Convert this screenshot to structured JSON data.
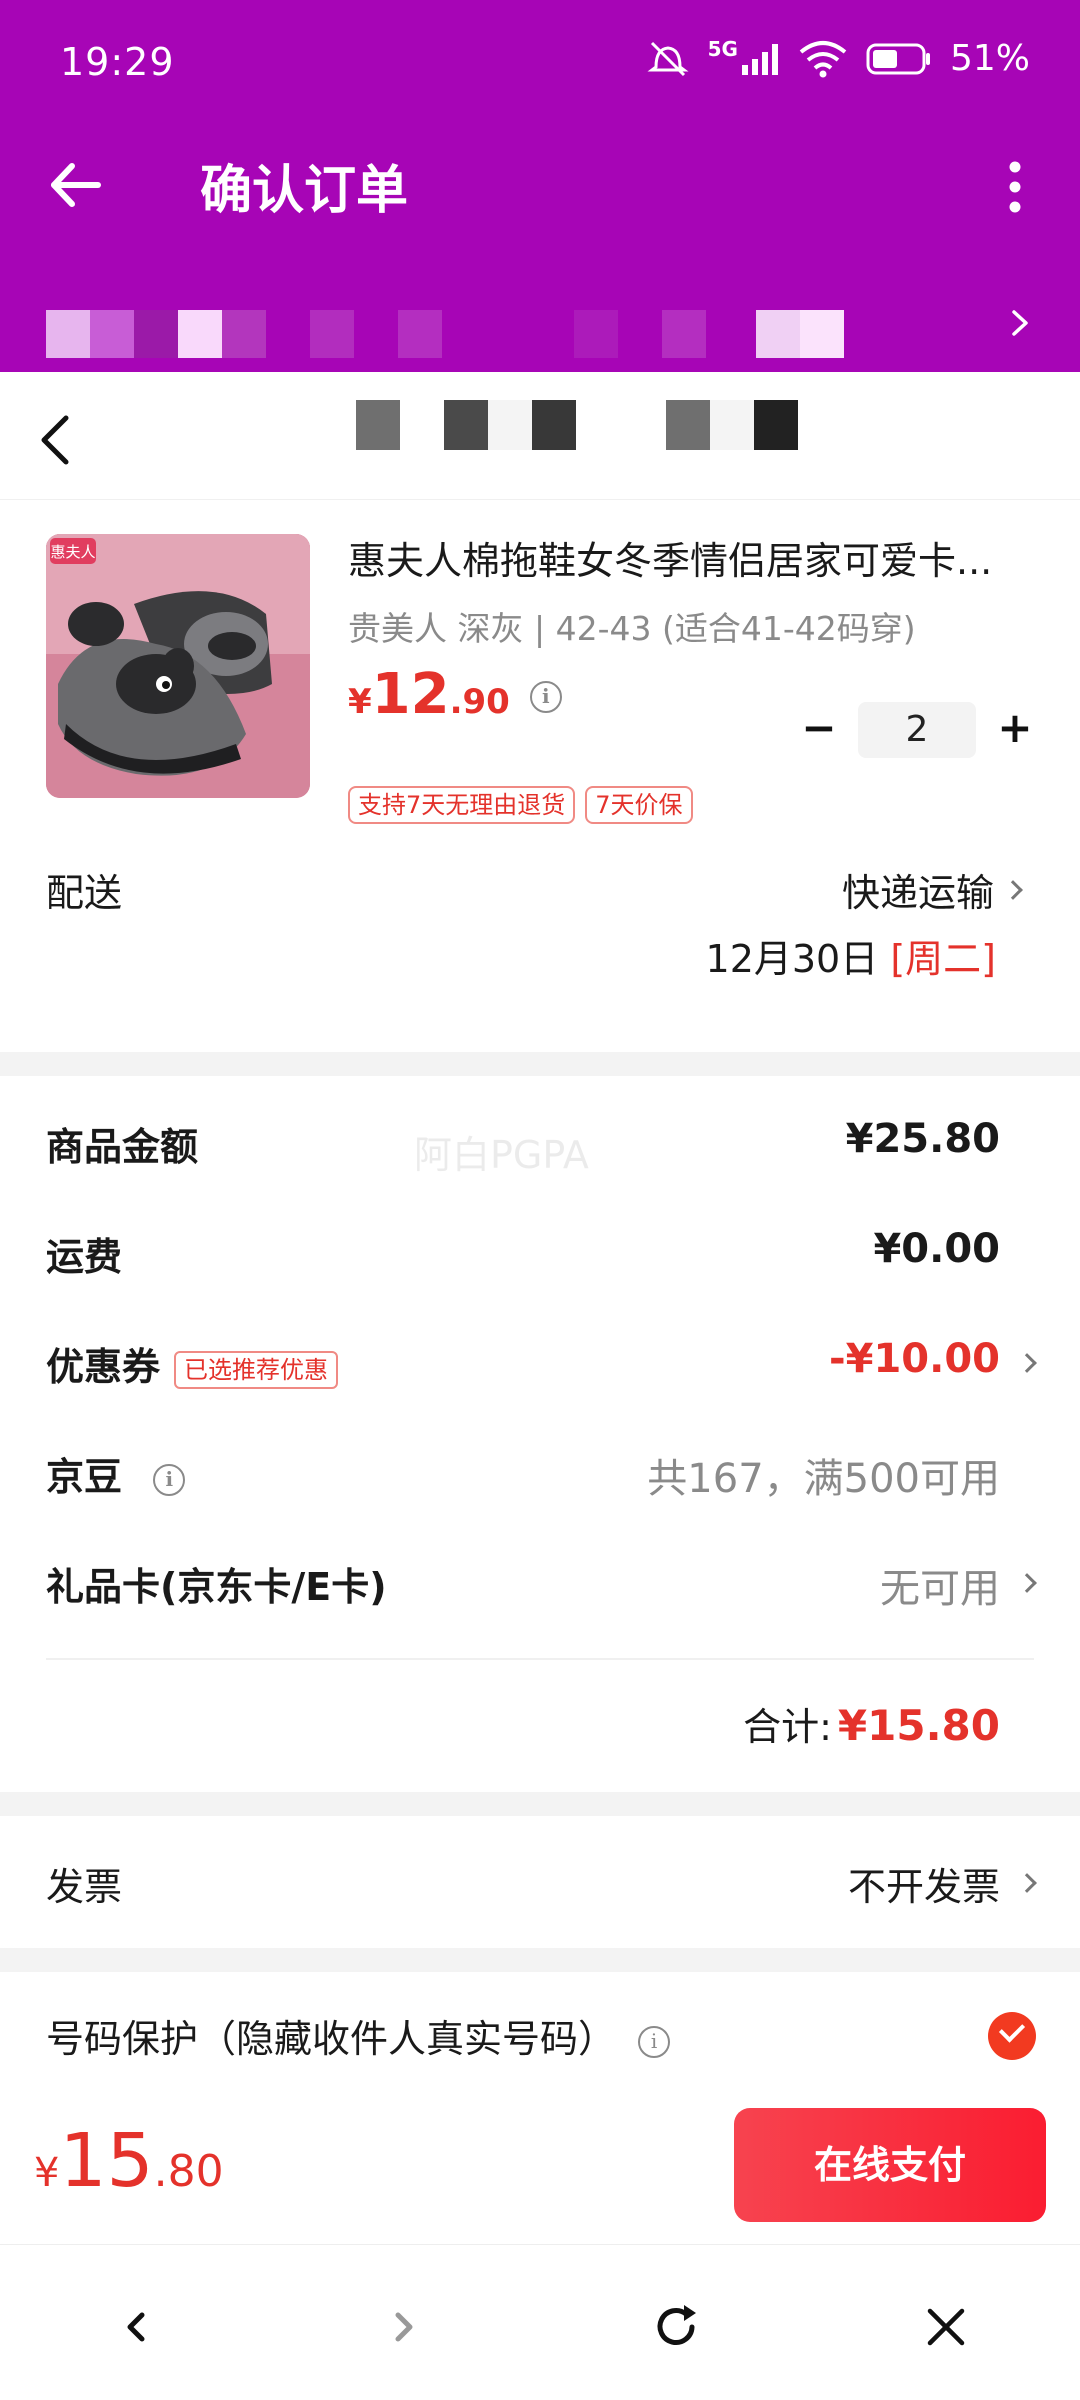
{
  "status_bar": {
    "time": "19:29",
    "network": "5G",
    "battery": "51%"
  },
  "header": {
    "title": "确认订单"
  },
  "product": {
    "image_brand": "惠夫人",
    "title": "惠夫人棉拖鞋女冬季情侣居家可爱卡...",
    "spec": "贵美人 深灰 | 42-43 (适合41-42码穿)",
    "price_currency": "¥",
    "price_int": "12",
    "price_dec": ".90",
    "quantity": "2",
    "minus": "−",
    "plus": "+",
    "tags": [
      "支持7天无理由退货",
      "7天价保"
    ]
  },
  "delivery": {
    "label": "配送",
    "method": "快递运输",
    "date": "12月30日",
    "weekday": "[周二]"
  },
  "summary": {
    "watermark": "阿白PGPA",
    "goods_label": "商品金额",
    "goods_value": "¥25.80",
    "shipping_label": "运费",
    "shipping_value": "¥0.00",
    "coupon_label": "优惠券",
    "coupon_badge": "已选推荐优惠",
    "coupon_value": "-¥10.00",
    "jingdou_label": "京豆",
    "jingdou_value": "共167，满500可用",
    "giftcard_label": "礼品卡(京东卡/E卡)",
    "giftcard_value": "无可用",
    "total_label": "合计:",
    "total_value": "¥15.80"
  },
  "invoice": {
    "label": "发票",
    "value": "不开发票"
  },
  "privacy": {
    "label": "号码保护（隐藏收件人真实号码）"
  },
  "pay": {
    "currency": "¥",
    "int": "15",
    "dec": ".80",
    "button": "在线支付"
  },
  "colors": {
    "header_bg": "#a705b6",
    "accent_red": "#e4322b",
    "pay_button": "#fa1d31"
  }
}
